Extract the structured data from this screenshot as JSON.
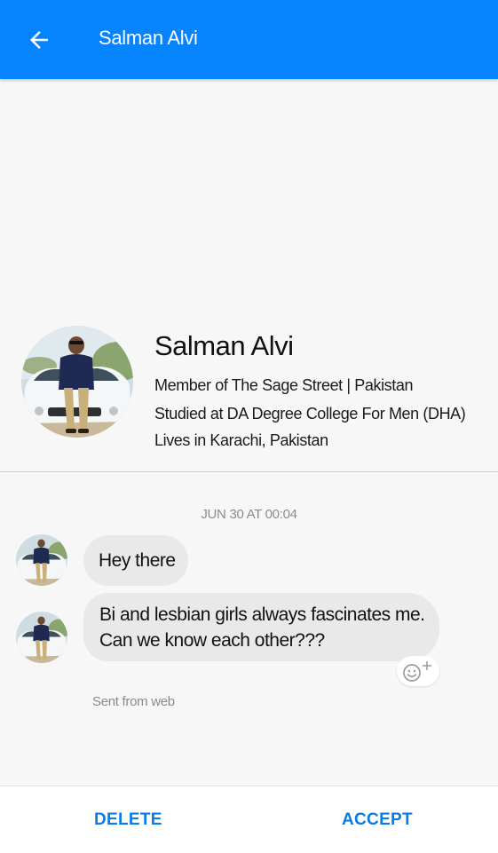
{
  "appbar": {
    "back_icon": "arrow-left-icon",
    "title": "Salman Alvi",
    "background": "#0584fe"
  },
  "profile": {
    "name": "Salman Alvi",
    "line1": "Member of The Sage Street | Pakistan",
    "line2": "Studied at DA Degree College For Men (DHA)",
    "line3": "Lives in Karachi, Pakistan"
  },
  "conversation": {
    "timestamp": "JUN 30 AT 00:04",
    "messages": [
      {
        "lines": [
          "Hey there"
        ]
      },
      {
        "lines": [
          "Bi and lesbian girls always fascinates me.",
          "Can we know each other???"
        ]
      }
    ],
    "reaction_icon": "add-reaction-smiley-icon",
    "sent_from": "Sent from web"
  },
  "actions": {
    "delete": "DELETE",
    "accept": "ACCEPT",
    "accent": "#0a7ce5"
  }
}
